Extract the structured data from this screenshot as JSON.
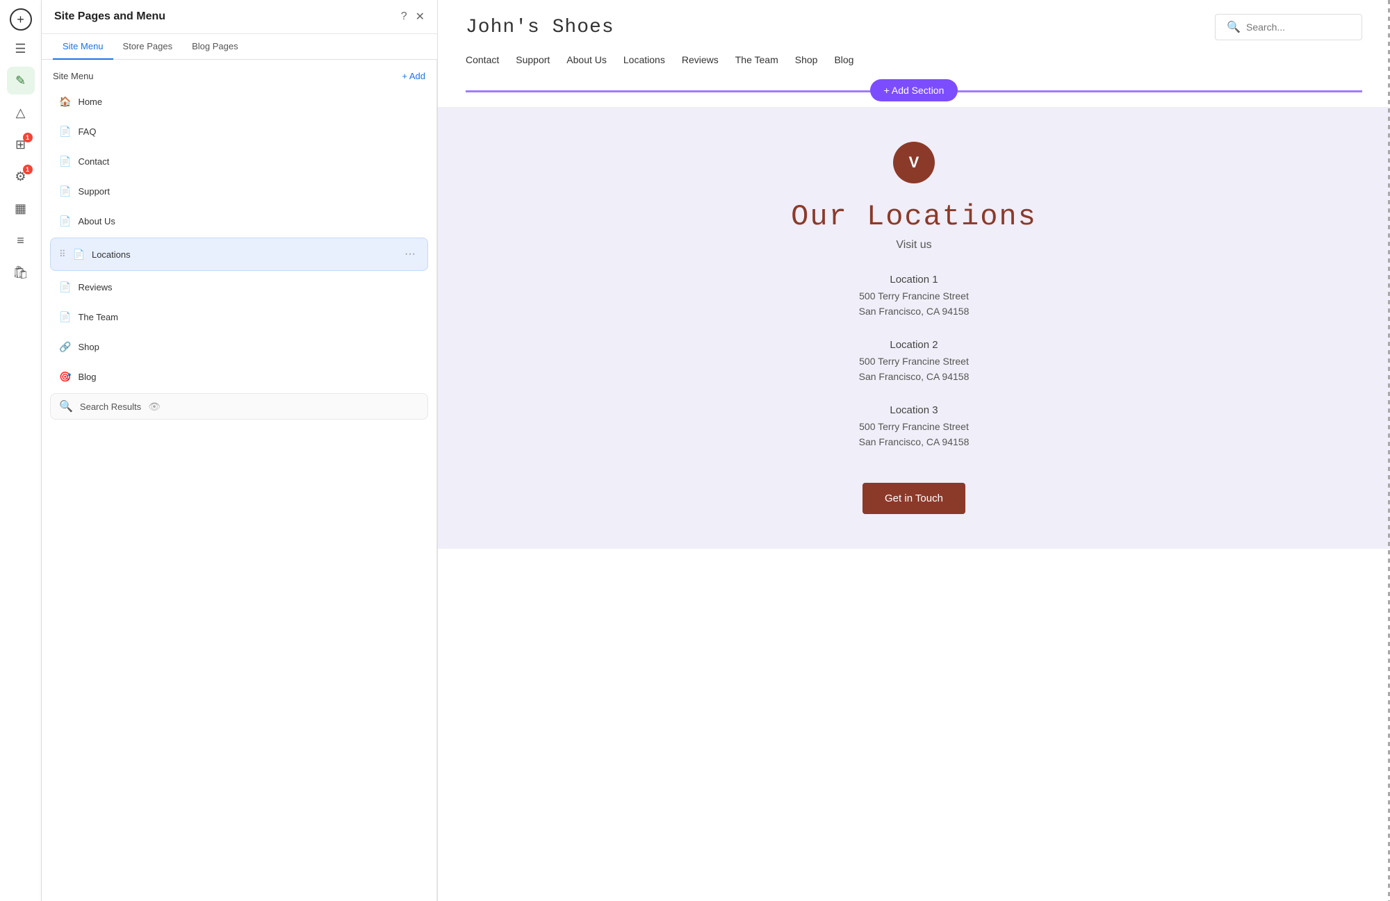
{
  "app": {
    "panel_title": "Site Pages and Menu",
    "help_icon": "?",
    "close_icon": "✕"
  },
  "tabs": [
    {
      "id": "site-menu",
      "label": "Site Menu",
      "active": true
    },
    {
      "id": "store-pages",
      "label": "Store Pages",
      "active": false
    },
    {
      "id": "blog-pages",
      "label": "Blog Pages",
      "active": false
    }
  ],
  "site_menu": {
    "title": "Site Menu",
    "add_label": "+ Add",
    "pages": [
      {
        "id": "home",
        "name": "Home",
        "icon": "🏠",
        "active": false,
        "draggable": false
      },
      {
        "id": "faq",
        "name": "FAQ",
        "icon": "📄",
        "active": false,
        "draggable": false
      },
      {
        "id": "contact",
        "name": "Contact",
        "icon": "📄",
        "active": false,
        "draggable": false
      },
      {
        "id": "support",
        "name": "Support",
        "icon": "📄",
        "active": false,
        "draggable": false
      },
      {
        "id": "about-us",
        "name": "About Us",
        "icon": "📄",
        "active": false,
        "draggable": false
      },
      {
        "id": "locations",
        "name": "Locations",
        "icon": "📄",
        "active": true,
        "draggable": true
      },
      {
        "id": "reviews",
        "name": "Reviews",
        "icon": "📄",
        "active": false,
        "draggable": false
      },
      {
        "id": "the-team",
        "name": "The Team",
        "icon": "📄",
        "active": false,
        "draggable": false
      },
      {
        "id": "shop",
        "name": "Shop",
        "icon": "🔗",
        "active": false,
        "draggable": false
      },
      {
        "id": "blog",
        "name": "Blog",
        "icon": "🎯",
        "active": false,
        "draggable": false
      }
    ],
    "search_results": {
      "name": "Search Results",
      "icon": "🔍"
    }
  },
  "left_sidebar": {
    "icons": [
      {
        "id": "plus",
        "symbol": "+",
        "type": "plus"
      },
      {
        "id": "pages",
        "symbol": "☰",
        "type": "icon"
      },
      {
        "id": "editor",
        "symbol": "✎",
        "type": "icon",
        "active": true,
        "accent": true
      },
      {
        "id": "design",
        "symbol": "△",
        "type": "icon"
      },
      {
        "id": "apps",
        "symbol": "⊞",
        "type": "icon",
        "badge": "1"
      },
      {
        "id": "integrations",
        "symbol": "⚙",
        "type": "icon",
        "badge": "1"
      },
      {
        "id": "media",
        "symbol": "▦",
        "type": "icon"
      },
      {
        "id": "blog",
        "symbol": "≡",
        "type": "icon"
      },
      {
        "id": "store",
        "symbol": "🛍",
        "type": "icon"
      }
    ]
  },
  "preview": {
    "site_title": "John's Shoes",
    "search_placeholder": "Search...",
    "nav_items": [
      {
        "id": "contact",
        "label": "Contact"
      },
      {
        "id": "support",
        "label": "Support"
      },
      {
        "id": "about-us",
        "label": "About Us"
      },
      {
        "id": "locations",
        "label": "Locations"
      },
      {
        "id": "reviews",
        "label": "Reviews"
      },
      {
        "id": "the-team",
        "label": "The Team"
      },
      {
        "id": "shop",
        "label": "Shop"
      },
      {
        "id": "blog",
        "label": "Blog"
      }
    ],
    "add_section_label": "+ Add Section",
    "logo_letter": "V",
    "locations_title": "Our Locations",
    "locations_subtitle": "Visit us",
    "locations": [
      {
        "id": "location-1",
        "name": "Location 1",
        "street": "500 Terry Francine Street",
        "city": "San Francisco, CA 94158"
      },
      {
        "id": "location-2",
        "name": "Location 2",
        "street": "500 Terry Francine Street",
        "city": "San Francisco, CA 94158"
      },
      {
        "id": "location-3",
        "name": "Location 3",
        "street": "500 Terry Francine Street",
        "city": "San Francisco, CA 94158"
      }
    ],
    "cta_button_label": "Get in Touch"
  }
}
